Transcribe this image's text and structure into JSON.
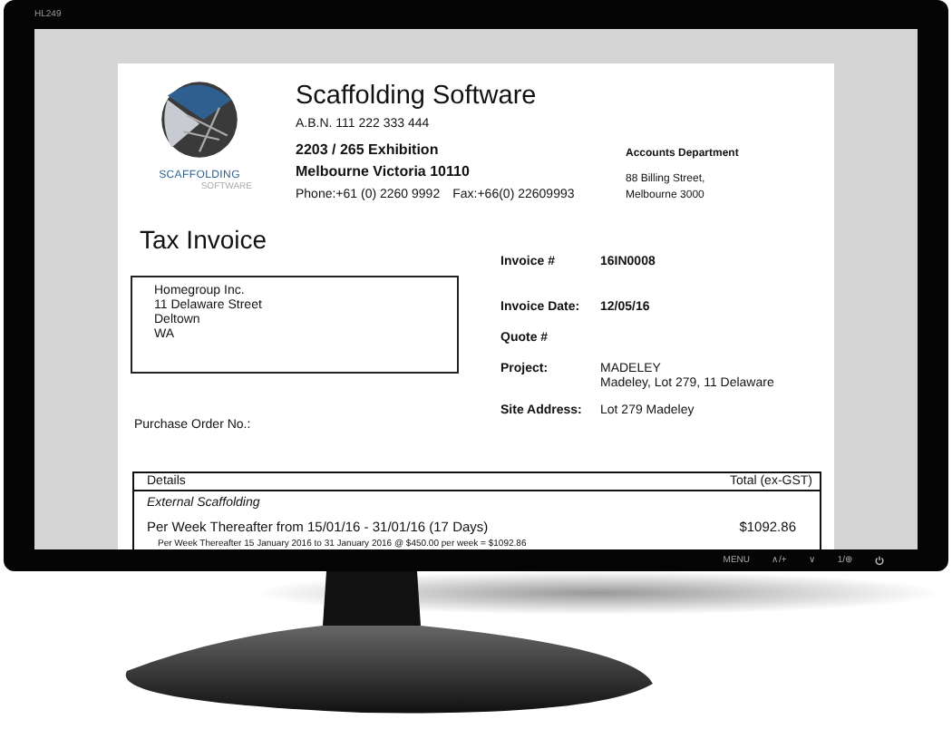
{
  "monitor": {
    "model": "HL249",
    "buttons": [
      "MENU",
      "∧/+",
      "∨",
      "1/⊕"
    ]
  },
  "invoice": {
    "logo": {
      "line1": "SCAFFOLDING",
      "line2": "SOFTWARE"
    },
    "company": {
      "name": "Scaffolding Software",
      "abn": "A.B.N.  111 222 333 444",
      "address_lines": [
        "2203 / 265 Exhibition",
        "Melbourne Victoria 10110"
      ],
      "phone": "Phone:+61 (0) 2260 9992",
      "fax": "Fax:+66(0) 22609993"
    },
    "accounts": {
      "title": "Accounts Department",
      "lines": [
        "88 Billing Street,",
        "Melbourne 3000"
      ]
    },
    "title": "Tax Invoice",
    "bill_to": [
      "Homegroup Inc.",
      "11 Delaware Street",
      "Deltown",
      "WA"
    ],
    "fields": [
      {
        "label": "Invoice #",
        "values": [
          "16IN0008"
        ]
      },
      {
        "label": "Invoice Date:",
        "values": [
          "12/05/16"
        ]
      },
      {
        "label": "Quote #"
      },
      {
        "label": "Project:",
        "values": [
          "MADELEY",
          "Madeley, Lot 279, 11 Delaware"
        ]
      },
      {
        "label": "Site Address:",
        "values": [
          "Lot 279 Madeley"
        ]
      }
    ],
    "purchase_order_label": "Purchase Order No.:",
    "table": {
      "columns": [
        "Details",
        "Total (ex-GST)"
      ],
      "rows": [
        {
          "kind": "section",
          "text": "External Scaffolding"
        },
        {
          "kind": "item",
          "text": "Per Week Thereafter from 15/01/16 - 31/01/16 (17 Days)",
          "amount": "$1092.86"
        },
        {
          "kind": "note",
          "text": "Per Week Thereafter 15 January 2016 to 31 January 2016 @ $450.00 per week = $1092.86"
        }
      ]
    }
  }
}
